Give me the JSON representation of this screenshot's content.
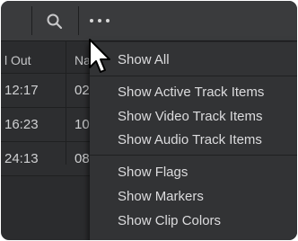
{
  "columns": [
    {
      "label": "l Out"
    },
    {
      "label": "Na"
    }
  ],
  "rows": [
    {
      "out": "12:17",
      "name": "02"
    },
    {
      "out": "16:23",
      "name": "10"
    },
    {
      "out": "24:13",
      "name": "08"
    }
  ],
  "toolbar": {
    "search_icon": "search-icon",
    "more_icon": "more-options-icon"
  },
  "menu": {
    "show_all": "Show All",
    "show_active_track_items": "Show Active Track Items",
    "show_video_track_items": "Show Video Track Items",
    "show_audio_track_items": "Show Audio Track Items",
    "show_flags": "Show Flags",
    "show_markers": "Show Markers",
    "show_clip_colors": "Show Clip Colors"
  },
  "colors": {
    "panel_bg": "#2b2c2e",
    "toolbar_bg": "#3a3b3d",
    "menu_bg": "#323335",
    "text": "#dcdcde"
  }
}
